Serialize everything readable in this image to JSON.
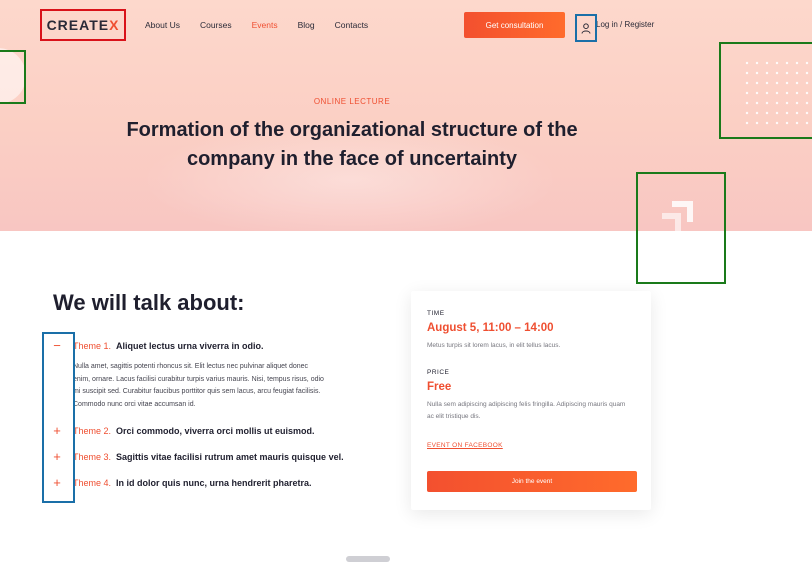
{
  "nav": {
    "logo_main": "CREATE",
    "logo_x": "X",
    "links": [
      "About Us",
      "Courses",
      "Events",
      "Blog",
      "Contacts"
    ],
    "consult_label": "Get consultation",
    "login_label": "Log in / Register"
  },
  "hero": {
    "eyebrow": "ONLINE LECTURE",
    "title_line1": "Formation of the organizational structure of the",
    "title_line2": "company in the face of uncertainty"
  },
  "talk": {
    "title": "We will talk about:",
    "themes": [
      {
        "label": "Theme 1.",
        "text": "Aliquet lectus urna viverra in odio.",
        "toggle": "−",
        "expanded": true,
        "body": [
          "Nulla amet, sagittis potenti rhoncus sit. Elit lectus nec pulvinar aliquet donec",
          "enim, ornare. Lacus facilisi curabitur turpis varius mauris. Nisi, tempus risus, odio",
          "mi suscipit sed. Curabitur faucibus porttitor quis sem lacus, arcu feugiat facilisis.",
          "Commodo nunc orci vitae accumsan id."
        ]
      },
      {
        "label": "Theme 2.",
        "text": "Orci commodo, viverra orci mollis ut euismod.",
        "toggle": "+",
        "expanded": false
      },
      {
        "label": "Theme 3.",
        "text": "Sagittis vitae facilisi rutrum amet mauris quisque vel.",
        "toggle": "+",
        "expanded": false
      },
      {
        "label": "Theme 4.",
        "text": "In id dolor quis nunc, urna hendrerit pharetra.",
        "toggle": "+",
        "expanded": false
      }
    ]
  },
  "card": {
    "time_label": "TIME",
    "time_value": "August 5, 11:00 – 14:00",
    "time_note": "Metus turpis sit lorem lacus, in elit tellus lacus.",
    "price_label": "PRICE",
    "price_value": "Free",
    "price_note": "Nulla sem adipiscing adipiscing felis fringilla. Adipiscing mauris quam ac elit tristique dis.",
    "fb_link": "EVENT ON FACEBOOK",
    "join_label": "Join the event"
  },
  "colors": {
    "accent": "#ef4f31",
    "hero_bg": "#fbd3c7",
    "text_dark": "#1f1f2e"
  },
  "icons": [
    "user-icon",
    "minus-icon",
    "plus-icon",
    "arrow-up-right-icon"
  ]
}
